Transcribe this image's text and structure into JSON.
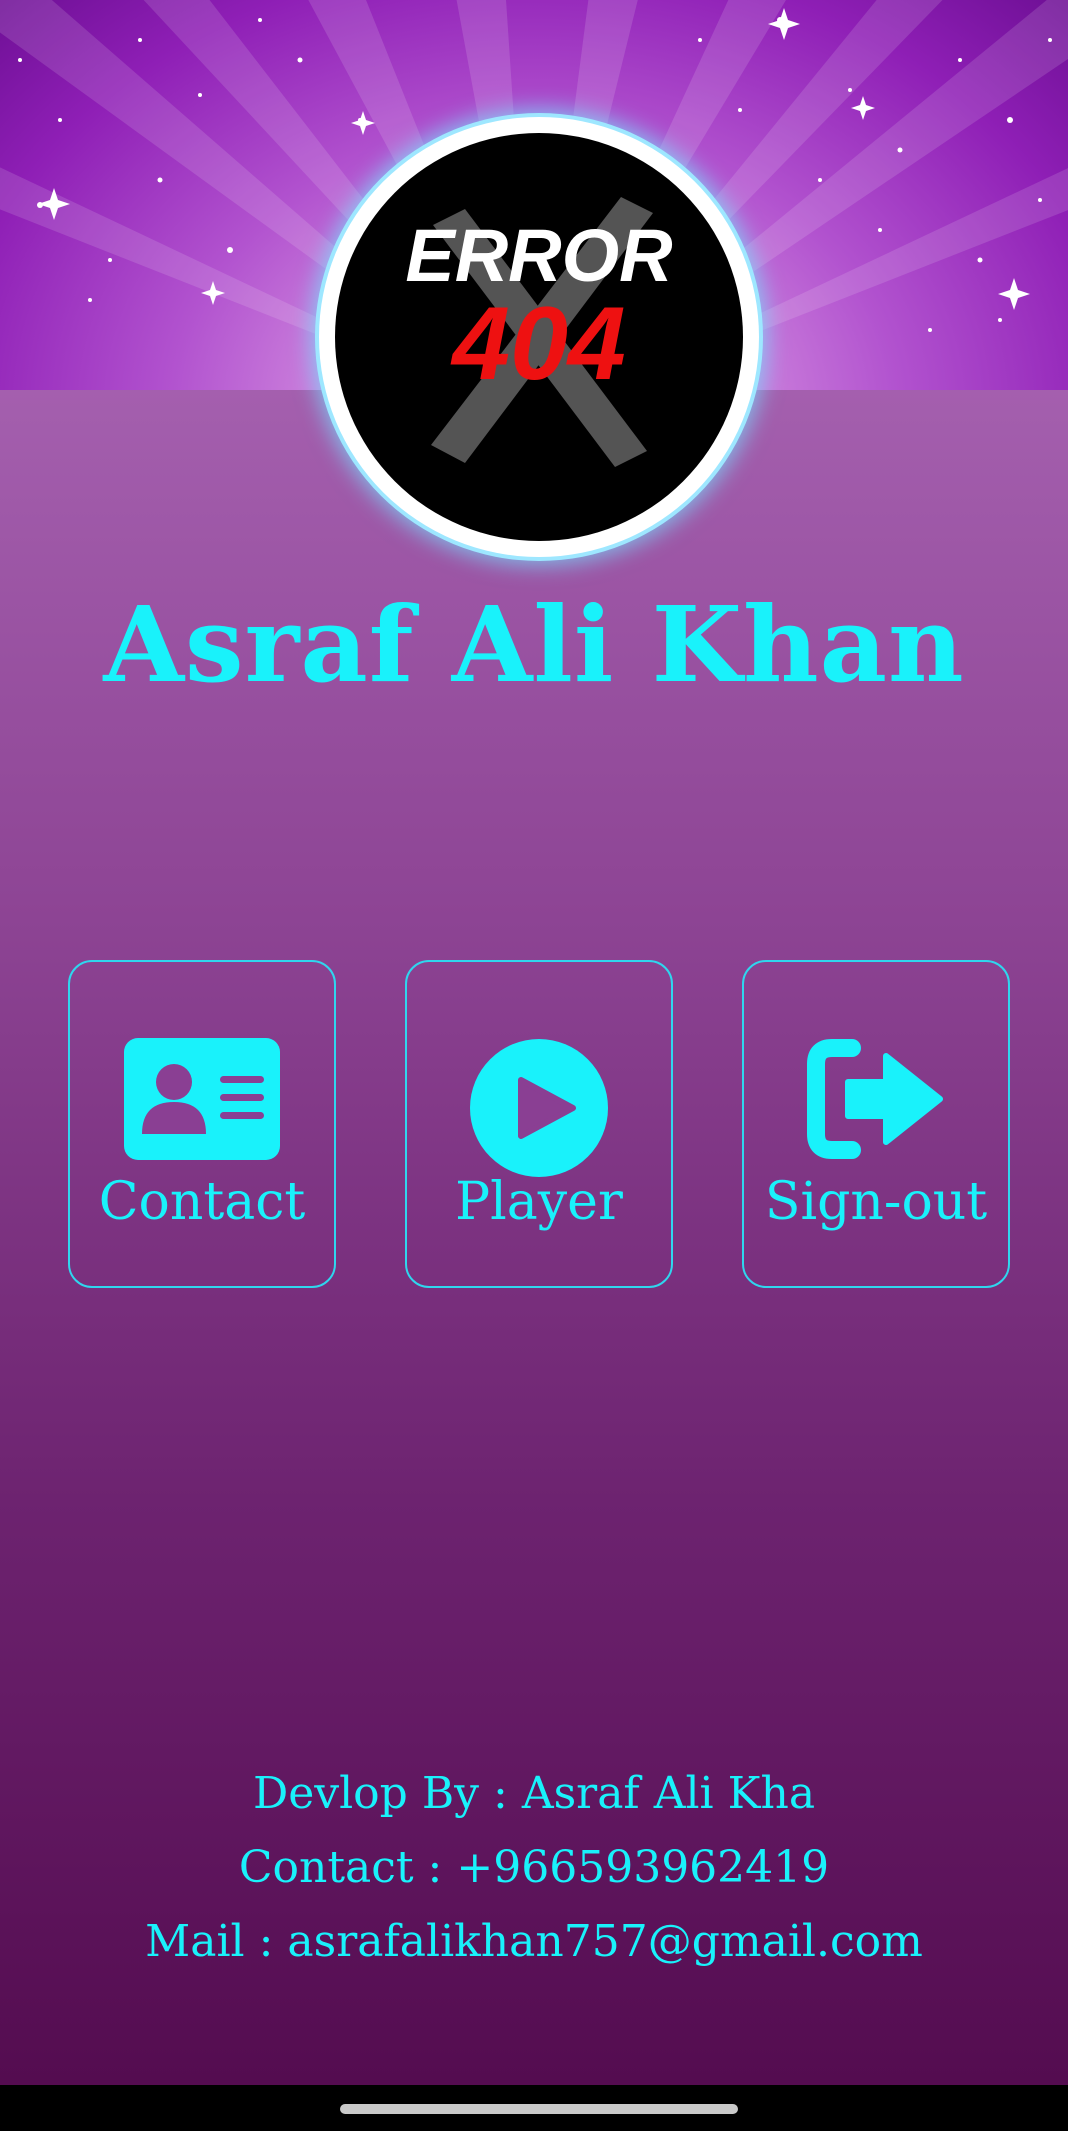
{
  "profile": {
    "avatar_logo_text_top": "ERROR",
    "avatar_logo_text_bottom": "404",
    "name": "Asraf Ali Khan"
  },
  "actions": [
    {
      "label": "Contact",
      "icon": "contact-card-icon"
    },
    {
      "label": "Player",
      "icon": "play-circle-icon"
    },
    {
      "label": "Sign-out",
      "icon": "sign-out-icon"
    }
  ],
  "footer": {
    "developer": "Devlop By : Asraf Ali Kha",
    "contact": "Contact : +966593962419",
    "mail": "Mail : asrafalikhan757@gmail.com"
  },
  "colors": {
    "accent": "#19f2fb",
    "background_top": "#a45fae",
    "background_bottom": "#540c50",
    "banner": "#9b2fc4"
  }
}
